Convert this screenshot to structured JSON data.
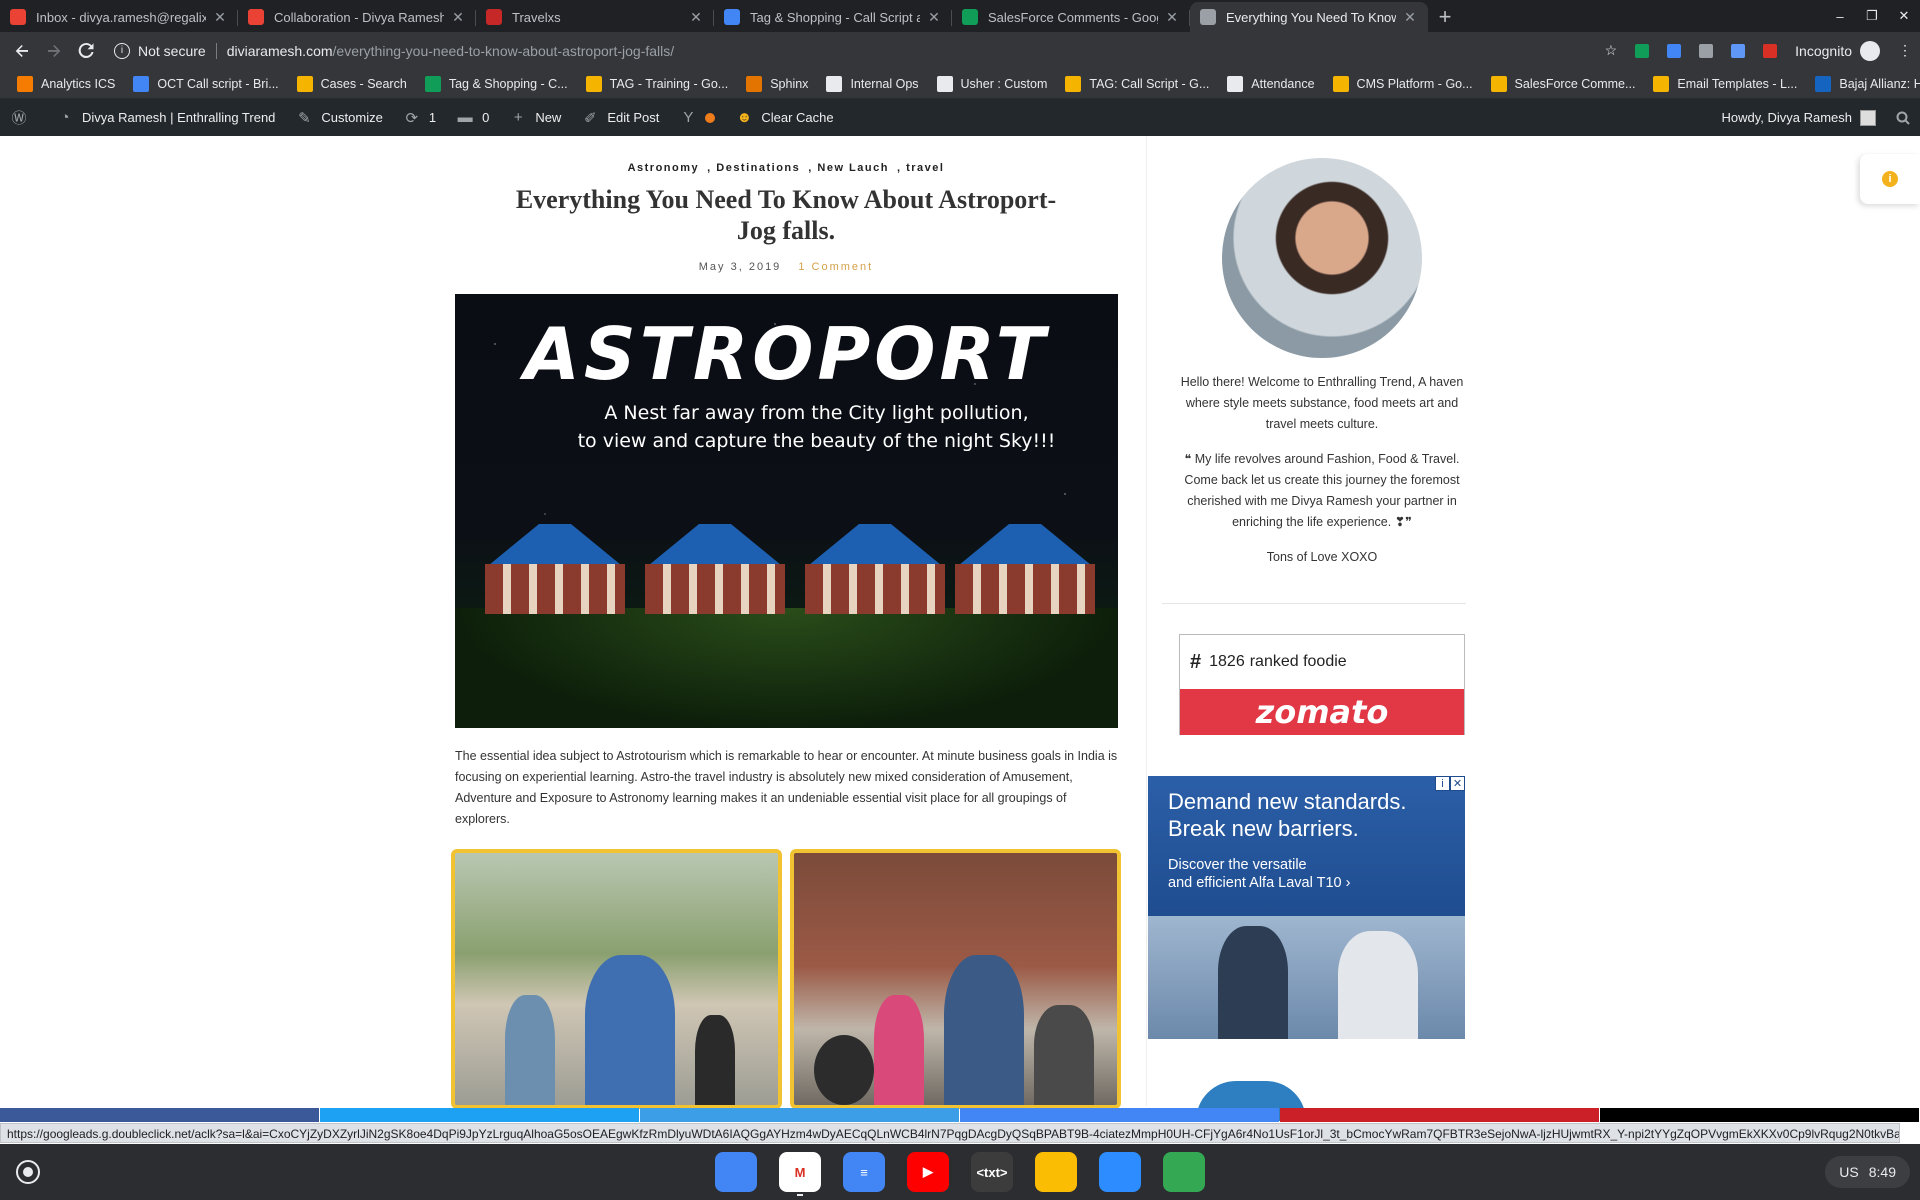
{
  "tabs": [
    {
      "title": "Inbox - divya.ramesh@regalix-in",
      "icon": "gmail-icon",
      "color": "#ea4335"
    },
    {
      "title": "Collaboration - Divya Ramesh - c",
      "icon": "gmail-icon",
      "color": "#ea4335"
    },
    {
      "title": "Travelxs",
      "icon": "travelxs-icon",
      "color": "#c62828"
    },
    {
      "title": "Tag & Shopping - Call Script and",
      "icon": "docs-icon",
      "color": "#4285f4"
    },
    {
      "title": "SalesForce Comments - Google",
      "icon": "sheets-icon",
      "color": "#0f9d58"
    },
    {
      "title": "Everything You Need To Know A",
      "icon": "page-icon",
      "color": "#9aa0a6",
      "active": true
    }
  ],
  "newtab_label": "+",
  "window_controls": [
    "–",
    "❐",
    "✕"
  ],
  "toolbar": {
    "not_secure": "Not secure",
    "host": "diviaramesh.com",
    "path": "/everything-you-need-to-know-about-astroport-jog-falls/",
    "incognito": "Incognito"
  },
  "bookmarks": [
    {
      "label": "Analytics ICS",
      "color": "#f57c00"
    },
    {
      "label": "OCT Call script - Bri...",
      "color": "#4285f4"
    },
    {
      "label": "Cases - Search",
      "color": "#f4b400"
    },
    {
      "label": "Tag & Shopping - C...",
      "color": "#0f9d58"
    },
    {
      "label": "TAG - Training - Go...",
      "color": "#f4b400"
    },
    {
      "label": "Sphinx",
      "color": "#e37400"
    },
    {
      "label": "Internal Ops",
      "color": "#e8eaed"
    },
    {
      "label": "Usher : Custom",
      "color": "#e8eaed"
    },
    {
      "label": "TAG: Call Script - G...",
      "color": "#f4b400"
    },
    {
      "label": "Attendance",
      "color": "#e8eaed"
    },
    {
      "label": "CMS Platform - Go...",
      "color": "#f4b400"
    },
    {
      "label": "SalesForce Comme...",
      "color": "#f4b400"
    },
    {
      "label": "Email Templates - L...",
      "color": "#f4b400"
    },
    {
      "label": "Bajaj Allianz: Healt...",
      "color": "#1565c0"
    }
  ],
  "bookmarks_more": "»",
  "wp_admin": {
    "site": "Divya Ramesh | Enthralling Trend",
    "customize": "Customize",
    "updates": "1",
    "comments": "0",
    "new": "New",
    "edit_post": "Edit Post",
    "clear_cache": "Clear Cache",
    "howdy": "Howdy, Divya Ramesh"
  },
  "post": {
    "categories": [
      "Astronomy",
      ", Destinations",
      ", New Lauch",
      ", travel"
    ],
    "title": "Everything You Need To Know About Astroport-Jog falls.",
    "date": "May 3, 2019",
    "comments": "1 Comment",
    "hero_logo": "ASTROPORT",
    "hero_line1": "A Nest far away from the City light pollution,",
    "hero_line2": "to view and capture the beauty of the night Sky!!!",
    "paragraph": "The essential idea subject to Astrotourism which is remarkable to hear or encounter. At minute business goals in India is focusing on experiential learning. Astro-the travel industry is absolutely new mixed consideration of Amusement, Adventure and Exposure to Astronomy learning makes it an undeniable essential visit place for all groupings of explorers."
  },
  "sidebar": {
    "bio1": "Hello there! Welcome to Enthralling Trend, A haven where style meets substance, food meets art and travel meets culture.",
    "bio2": "❝ My life revolves around Fashion, Food & Travel. Come back let us create this journey the foremost cherished with me Divya Ramesh your partner in enriching the life experience. ❣❞",
    "bio3": "Tons of Love XOXO",
    "zomato_hash": "#",
    "zomato_rank": "1826",
    "zomato_text": "ranked foodie",
    "zomato_brand": "zomato",
    "ad_headline1": "Demand new standards.",
    "ad_headline2": "Break new barriers.",
    "ad_sub1": "Discover the versatile",
    "ad_sub2": "and efficient Alfa Laval T10 ›",
    "ad_info": "i",
    "ad_close": "✕"
  },
  "share_colors": [
    "#3b5998",
    "#1da1f2",
    "#3b9ee6",
    "#4285f4",
    "#cb2027",
    "#000000"
  ],
  "status_url": "https://googleads.g.doubleclick.net/aclk?sa=l&ai=CxoCYjZyDXZyrlJiN2gSK8oe4DqPi9JpYzLrguqAlhoaG5osOEAEgwKfzRmDlyuWDtA6IAQGgAYHzm4wDyAECqQLnWCB4lrN7PqgDAcgDyQSqBPABT9B-4ciatezMmpH0UH-CFjYgA6r4No1UsF1orJl_3t_bCmocYwRam7QFBTR3eSejoNwA-ljzHUjwmtRX_Y-npi2tYYgZqOPVvgmEkXKXv0Cp9lvRqug2N0tkvBa...",
  "shelf": {
    "apps": [
      {
        "name": "files-app",
        "label": "",
        "color": "#4285f4"
      },
      {
        "name": "gmail-app",
        "label": "M",
        "color": "#ffffff",
        "open": true
      },
      {
        "name": "docs-app",
        "label": "≡",
        "color": "#4285f4"
      },
      {
        "name": "youtube-app",
        "label": "▶",
        "color": "#ff0000"
      },
      {
        "name": "text-app",
        "label": "<txt>",
        "color": "#3c3c3c"
      },
      {
        "name": "keep-app",
        "label": "",
        "color": "#fbbc04"
      },
      {
        "name": "zoom-app",
        "label": "",
        "color": "#2d8cff"
      },
      {
        "name": "chrome-app",
        "label": "",
        "color": "#34a853"
      }
    ],
    "locale": "US",
    "time": "8:49"
  }
}
